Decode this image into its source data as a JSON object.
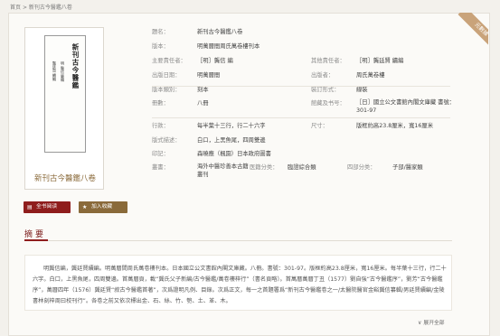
{
  "breadcrumb": {
    "home": "首页",
    "sep": ">",
    "current": "新刊古今醫鑑八卷"
  },
  "cover": {
    "title_vertical": "新刊古今醫鑑",
    "side_text_1": "明 龔信 纂輯",
    "side_text_2": "龔廷賢 續編",
    "caption": "新刊古今醫鑑八卷"
  },
  "buttons": {
    "read": "全书阅读",
    "favorite": "加入收藏"
  },
  "ribbon": "元數據",
  "info": {
    "title_label": "題名：",
    "title_value": "新刊古今醫鑑八卷",
    "edition_label": "版本：",
    "edition_value": "明萬曆間周氏萬卷樓刊本",
    "author_label": "主要責任者：",
    "author_value": "［明］龔信 編",
    "other_author_label": "其他責任者：",
    "other_author_value": "［明］龔廷賢 續編",
    "pubtime_label": "出版日期：",
    "pubtime_value": "明萬曆間",
    "publisher_label": "出版者：",
    "publisher_value": "周氏萬卷樓",
    "edtype_label": "版本類別：",
    "edtype_value": "刻本",
    "binding_label": "裝訂形式：",
    "binding_value": "線裝",
    "volumes_label": "冊數：",
    "volumes_value": "八冊",
    "callno_label": "館藏及书号：",
    "callno_value": "［日］國立公文書館內閣文庫藏 書號：301-97",
    "lines_label": "行款：",
    "lines_value": "每半葉十三行，行二十六字",
    "size_label": "尺寸：",
    "size_value": "版框約高23.8厘米，寬16厘米",
    "format_label": "版式描述：",
    "format_value": "白口，上黑魚尾，四周雙邊",
    "seal_label": "印記：",
    "seal_value": "森曉應（楓園）日本政府圖書",
    "series_label": "叢書：",
    "series_value": "海外中醫珍善本古籍叢刊",
    "category_label": "医籍分类：",
    "category_value": "臨證綜合類",
    "siku_label": "四部分类：",
    "siku_value": "子部/醫家類"
  },
  "abstract": {
    "heading": "摘要",
    "text": "明龔信編，龔廷賢續編。明萬曆間周氏萬卷樓刊本。日本國立公文書館內閣文庫藏。八冊。書號：301-97。版框約高23.8厘米，寬16厘米。每半葉十三行，行二十六字。白口，上黑魚尾，四周雙邊。首萬曆頁，載“龔氏父子新編/古今醫鑑/萬卷樓梓行”（書名頁略）。首萬曆萬曆丁丑（1577）劉自強“古今醫鑑序”，劉芳“古今醫鑑序”，萬曆四年（1576）龔廷賢“敘古今醫鑑首著”，次爲證明凡例、目錄。次爲正文，每一之首題署爲“新刊古今醫鑑卷之一/太醫院醫官金谿龔信纂輯/男廷賢續編/金陵書林刻梓周曰校刊行”。各卷之前又依次標出金、石、絲、竹、匏、土、革、木。",
    "expand": "展开全部"
  }
}
